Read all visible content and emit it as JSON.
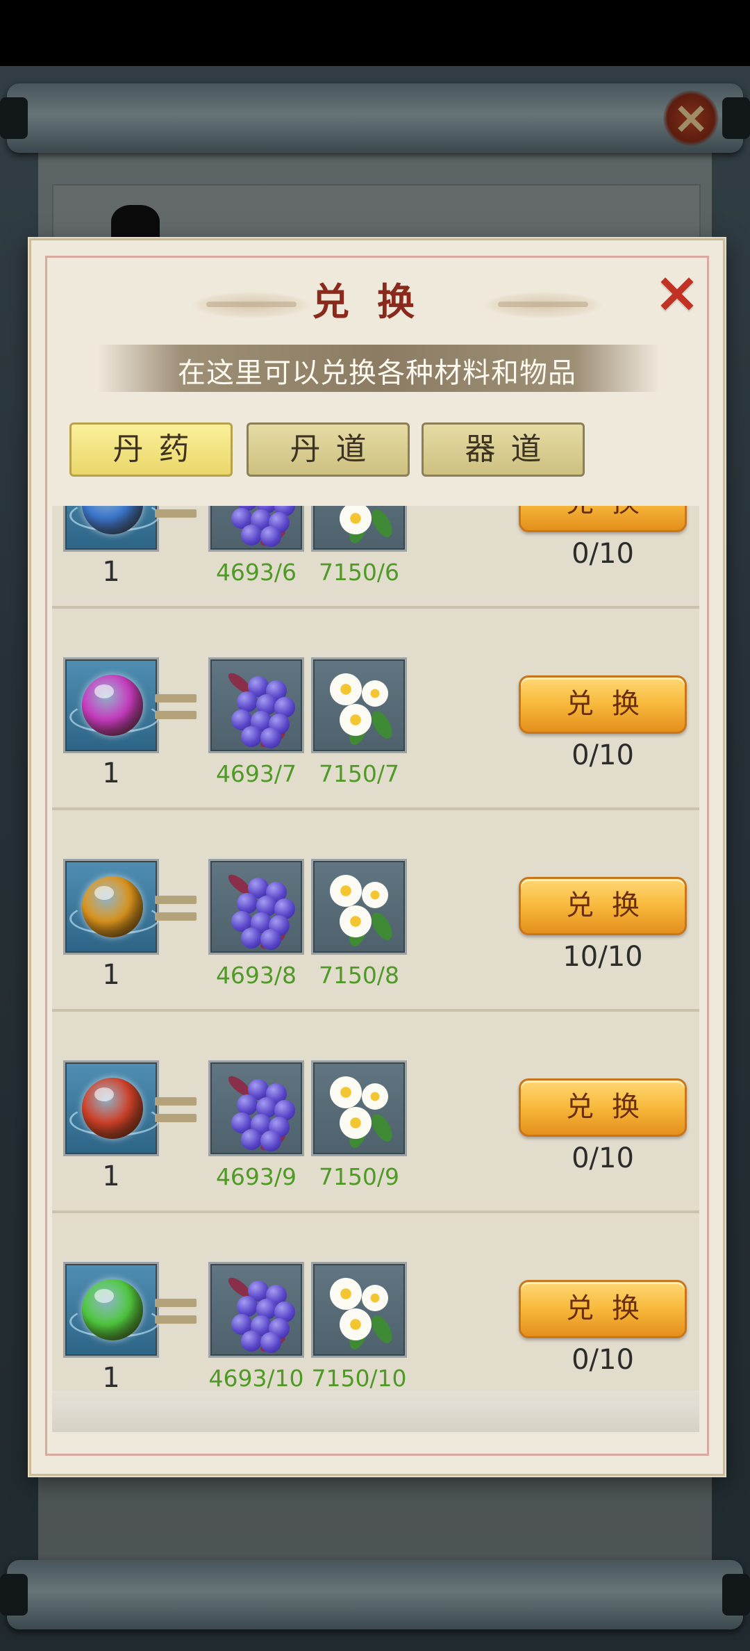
{
  "dialog": {
    "title": "兑换",
    "close_icon": "×",
    "subtitle": "在这里可以兑换各种材料和物品"
  },
  "background": {
    "close_icon": "×"
  },
  "tabs": [
    {
      "label": "丹药",
      "active": true
    },
    {
      "label": "丹道",
      "active": false
    },
    {
      "label": "器道",
      "active": false
    }
  ],
  "exchange_label": "兑换",
  "items": [
    {
      "result_icon": "blue-pill-icon",
      "color": "#3d7bd6",
      "qty": "1",
      "cost1": "4693/6",
      "cost2": "7150/6",
      "limit": "0/10"
    },
    {
      "result_icon": "purple-pill-icon",
      "color": "#d03dc7",
      "qty": "1",
      "cost1": "4693/7",
      "cost2": "7150/7",
      "limit": "0/10"
    },
    {
      "result_icon": "orange-pill-icon",
      "color": "#e49a1e",
      "qty": "1",
      "cost1": "4693/8",
      "cost2": "7150/8",
      "limit": "10/10"
    },
    {
      "result_icon": "red-pill-icon",
      "color": "#d8432a",
      "qty": "1",
      "cost1": "4693/9",
      "cost2": "7150/9",
      "limit": "0/10"
    },
    {
      "result_icon": "green-pill-icon",
      "color": "#52d040",
      "qty": "1",
      "cost1": "4693/10",
      "cost2": "7150/10",
      "limit": "0/10"
    }
  ],
  "material_icons": [
    "grape-herb-icon",
    "daisy-herb-icon"
  ]
}
